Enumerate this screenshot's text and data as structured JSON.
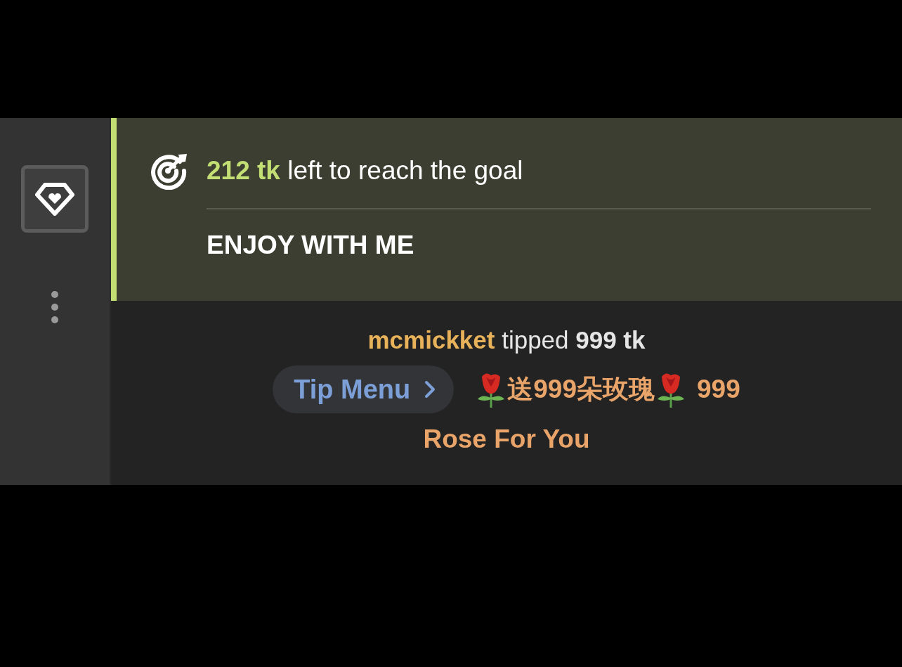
{
  "goal": {
    "text": "**212 tk** left to reach the goal",
    "title": "ENJOY WITH ME"
  },
  "tip": {
    "text": "**mcmickket** tipped **999 tk**",
    "button": "Tip Menu",
    "item": "送999朵玫瑰",
    "amount": "999",
    "message": "Rose For You"
  }
}
